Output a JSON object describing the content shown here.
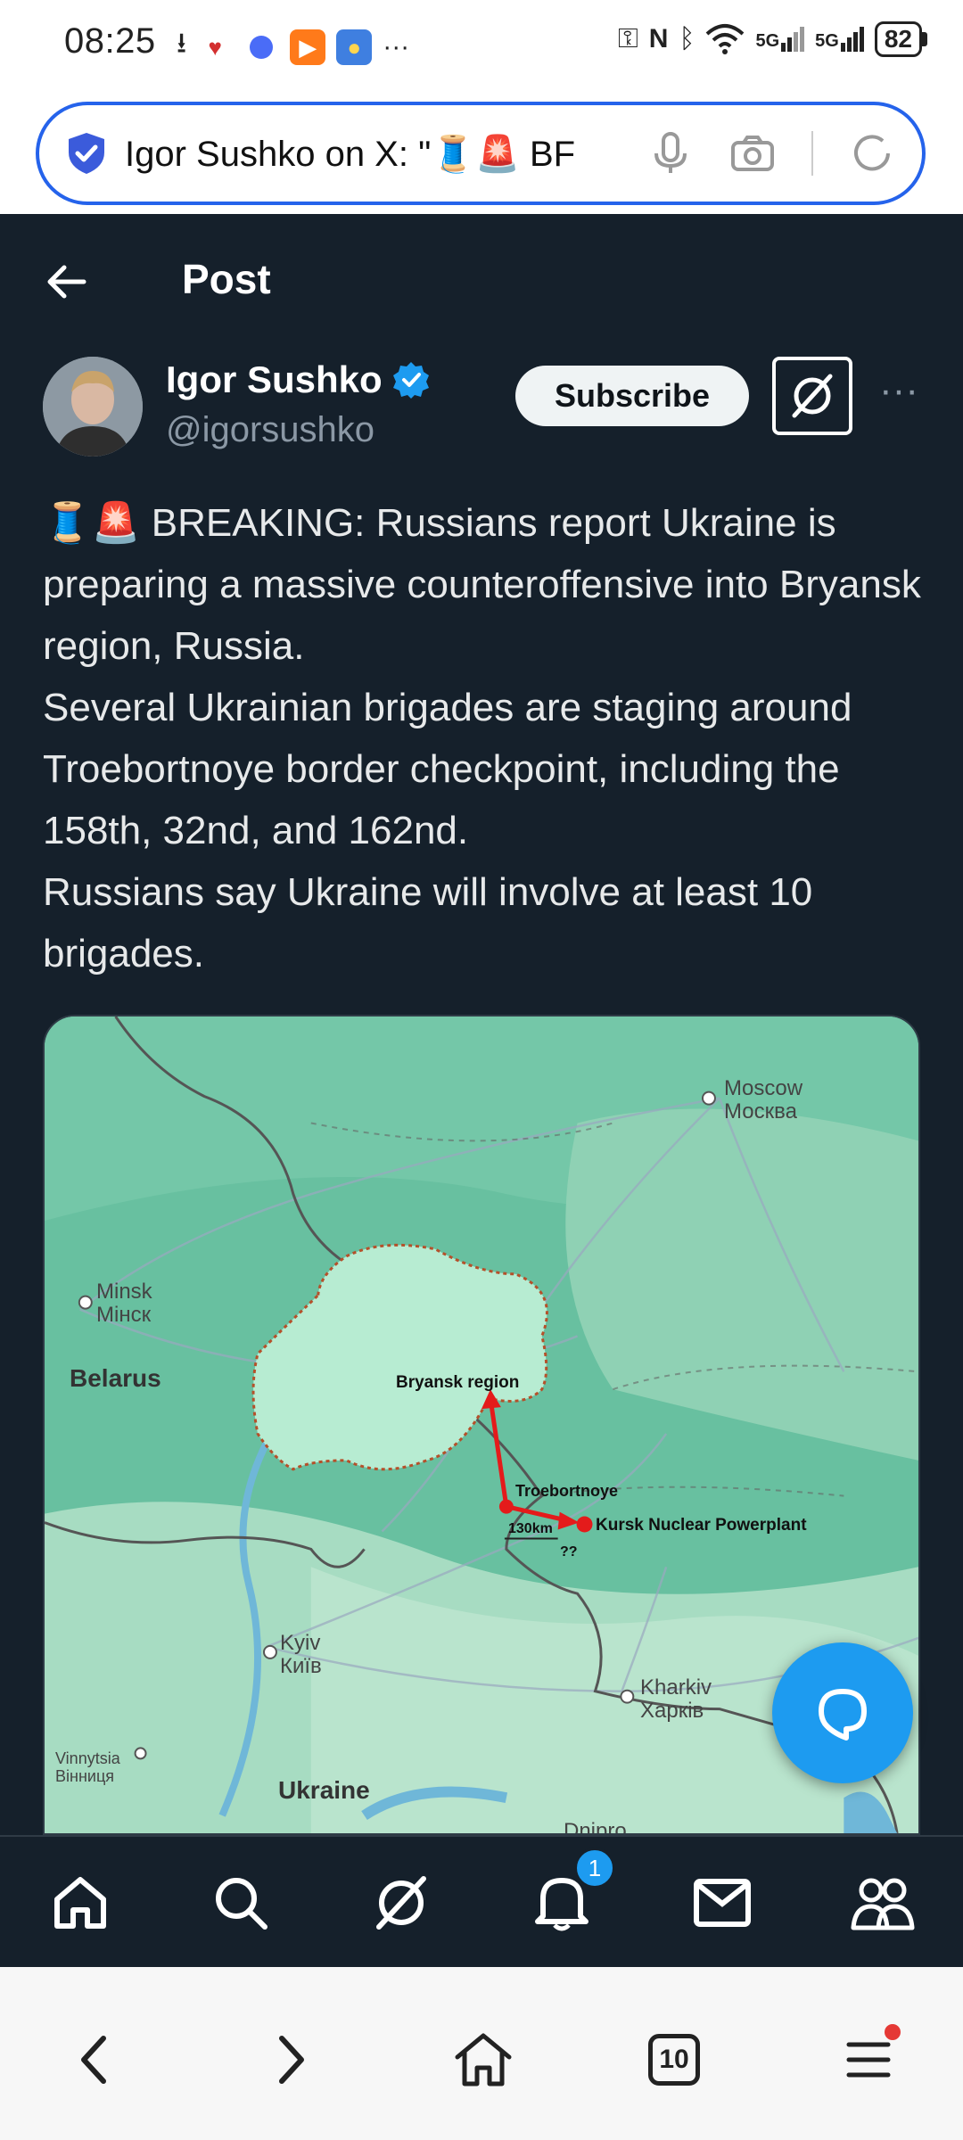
{
  "status": {
    "time": "08:25",
    "battery": "82",
    "signal1": "5G",
    "signal2": "5G"
  },
  "address_bar": {
    "url_text": "Igor Sushko on X: \"🧵🚨 BF"
  },
  "header": {
    "title": "Post"
  },
  "author": {
    "name": "Igor Sushko",
    "handle": "@igorsushko",
    "subscribe_label": "Subscribe"
  },
  "post": {
    "lines": [
      "🧵🚨 BREAKING: Russians report Ukraine is preparing a massive counteroffensive into Bryansk region, Russia.",
      "Several Ukrainian brigades are staging around Troebortnoye border checkpoint, including the 158th, 32nd, and 162nd.",
      "Russians say Ukraine will involve at least 10 brigades."
    ]
  },
  "map": {
    "labels": {
      "moscow_en": "Moscow",
      "moscow_ru": "Москва",
      "minsk_en": "Minsk",
      "minsk_ru": "Мінск",
      "belarus": "Belarus",
      "bryansk": "Bryansk region",
      "troebortnoye": "Troebortnoye",
      "distance": "130km",
      "kursk": "Kursk Nuclear Powerplant",
      "unknown": "??",
      "kyiv_en": "Kyiv",
      "kyiv_ua": "Київ",
      "kharkiv_en": "Kharkiv",
      "kharkiv_ua": "Харків",
      "vinnytsia_en": "Vinnytsia",
      "vinnytsia_ua": "Вінниця",
      "ukraine": "Ukraine",
      "dnipro": "Dnipro"
    }
  },
  "nav": {
    "notification_count": "1"
  },
  "browser": {
    "tab_count": "10"
  },
  "colors": {
    "background": "#15202b",
    "accent": "#1d9bf0",
    "address_border": "#2563eb",
    "map_land": "#68c0a0",
    "region_border": "#b5502a",
    "arrow": "#e41b1b"
  }
}
